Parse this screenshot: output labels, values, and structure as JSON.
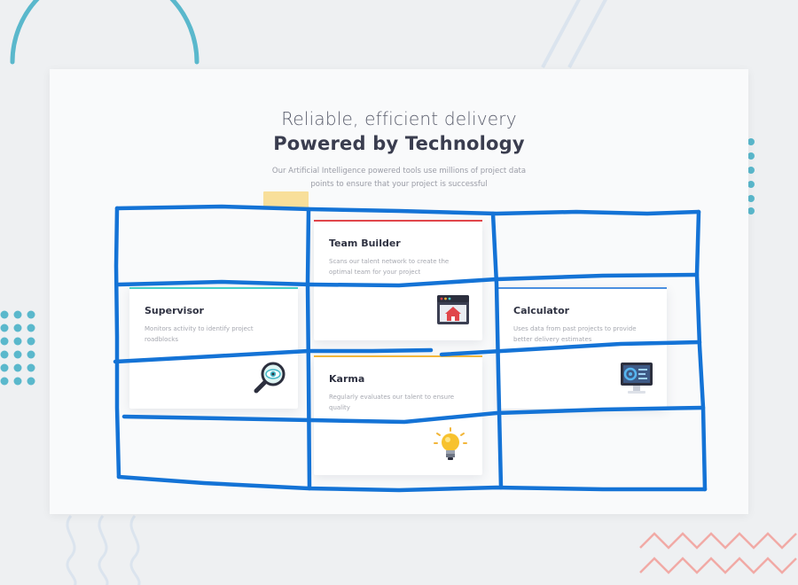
{
  "header": {
    "headline": "Reliable, efficient delivery",
    "subheadline": "Powered by Technology",
    "tagline": "Our Artificial Intelligence powered tools use millions of project data points to ensure that your project is successful"
  },
  "cards": {
    "team_builder": {
      "title": "Team Builder",
      "desc": "Scans our talent network to create the optimal team for your project",
      "accent": "#e0454a",
      "icon": "browser-house-icon"
    },
    "supervisor": {
      "title": "Supervisor",
      "desc": "Monitors activity to identify project roadblocks",
      "accent": "#44d0c8",
      "icon": "magnifier-eye-icon"
    },
    "calculator": {
      "title": "Calculator",
      "desc": "Uses data from past projects to provide better delivery estimates",
      "accent": "#4a8fe0",
      "icon": "monitor-dashboard-icon"
    },
    "karma": {
      "title": "Karma",
      "desc": "Regularly evaluates our talent to ensure quality",
      "accent": "#f2b63a",
      "icon": "lightbulb-icon"
    }
  },
  "colors": {
    "background": "#eef0f2",
    "panel": "#f9fafb",
    "ink": "#1473d6",
    "decor_teal": "#5ab8cc",
    "decor_pink": "#f1aaa6"
  }
}
